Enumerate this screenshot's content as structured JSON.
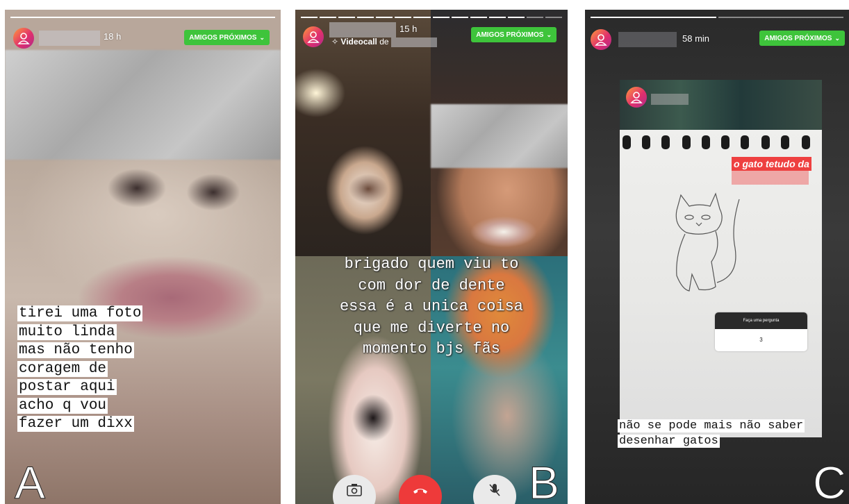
{
  "panels": {
    "a": {
      "letter": "A",
      "time": "18 h",
      "close_friends_label": "AMIGOS PRÓXIMOS",
      "caption_lines": [
        "tirei uma foto",
        "muito linda",
        "mas não tenho",
        "coragem de",
        "postar aqui",
        "acho q vou",
        "fazer um dixx"
      ]
    },
    "b": {
      "letter": "B",
      "time": "15 h",
      "close_friends_label": "AMIGOS PRÓXIMOS",
      "videocall_label": "Videocall",
      "videocall_suffix": "de",
      "caption_lines": [
        "brigado quem viu to",
        "com dor de dente",
        "essa é a unica coisa",
        "que me diverte no",
        "momento bjs fãs"
      ],
      "call_buttons": [
        "camera-flip",
        "end-call",
        "mute-mic"
      ]
    },
    "c": {
      "letter": "C",
      "time": "58 min",
      "close_friends_label": "AMIGOS PRÓXIMOS",
      "sticker_text": "o gato tetudo da",
      "question_box": {
        "title": "Faça uma pergunta",
        "answer": "3"
      },
      "caption_lines": [
        "não se pode mais não saber",
        "desenhar gatos"
      ]
    }
  },
  "colors": {
    "close_friends_green": "#3ec43b",
    "avatar_gradient": [
      "#ff9a3c",
      "#e1306c",
      "#b02a8a"
    ],
    "end_call_red": "#ee3a3a",
    "sticker_red": "#ee4040"
  },
  "icons": [
    "profile-avatar-icon",
    "chevron-down-icon",
    "sparkle-icon",
    "camera-flip-icon",
    "hang-up-icon",
    "microphone-icon"
  ]
}
